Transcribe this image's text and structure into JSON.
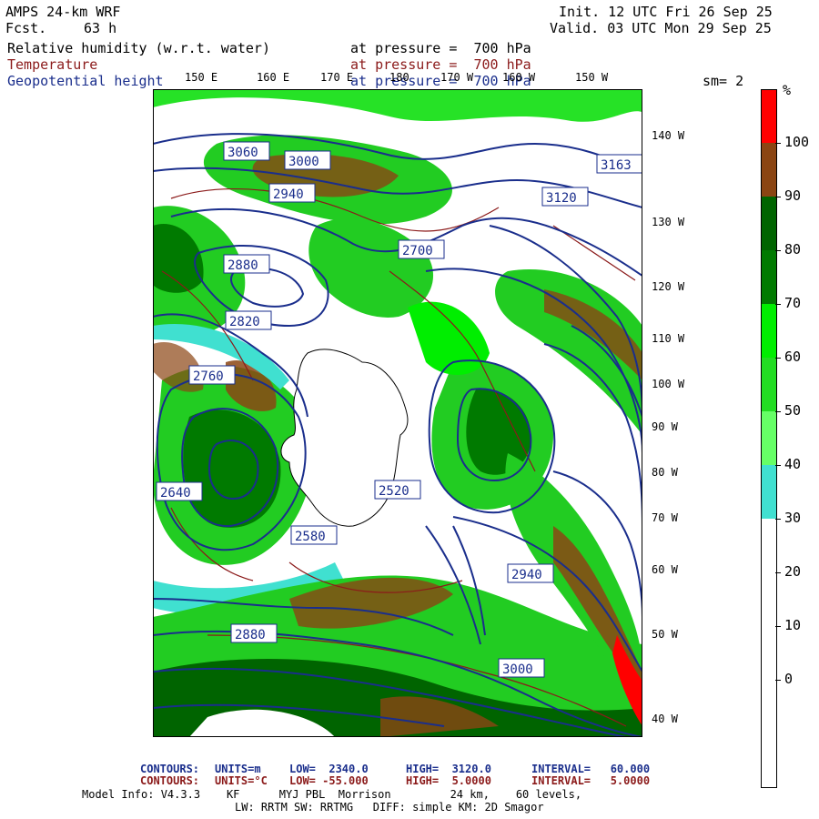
{
  "header": {
    "model": "AMPS 24-km WRF",
    "fcst_label": "Fcst.",
    "fcst_value": "63 h",
    "init": "Init. 12 UTC Fri 26 Sep 25",
    "valid": "Valid. 03 UTC Mon 29 Sep 25",
    "field1": "Relative humidity (w.r.t. water)",
    "field1_level": "at pressure =  700 hPa",
    "field2": "Temperature",
    "field2_level": "at pressure =  700 hPa",
    "field3": "Geopotential height",
    "field3_level": "at pressure =  700 hPa",
    "sm": "sm= 2"
  },
  "lon_labels": [
    "150 E",
    "160 E",
    "170 E",
    "180",
    "170 W",
    "160 W",
    "150 W"
  ],
  "lat_labels": [
    "140 W",
    "130 W",
    "120 W",
    "110 W",
    "100 W",
    "90 W",
    "80 W",
    "70 W",
    "60 W",
    "50 W",
    "40 W"
  ],
  "height_labels": [
    "3060",
    "3000",
    "2940",
    "2880",
    "2820",
    "2760",
    "2700",
    "2640",
    "2580",
    "2520",
    "3120",
    "3163",
    "2880",
    "2940",
    "3000"
  ],
  "colorbar": {
    "unit": "%",
    "colors": [
      "#ff0000",
      "#8b4513",
      "#006400",
      "#007a00",
      "#00ee00",
      "#22dd22",
      "#66ff66",
      "#40e0d0",
      "#ffffff",
      "#ffffff",
      "#ffffff",
      "#ffffff",
      "#ffffff"
    ],
    "labels": [
      "100",
      "90",
      "80",
      "70",
      "60",
      "50",
      "40",
      "30",
      "20",
      "10",
      "0"
    ]
  },
  "footer": {
    "c1_label": "CONTOURS:",
    "c1_units": "UNITS=m",
    "c1_low": "LOW=  2340.0",
    "c1_high": "HIGH=  3120.0",
    "c1_int": "INTERVAL=   60.000",
    "c2_label": "CONTOURS:",
    "c2_units": "UNITS=°C",
    "c2_low": "LOW= -55.000",
    "c2_high": "HIGH=  5.0000",
    "c2_int": "INTERVAL=   5.0000",
    "info1": "Model Info: V4.3.3    KF      MYJ PBL  Morrison         24 km,    60 levels,",
    "info2": "LW: RRTM SW: RRTMG   DIFF: simple KM: 2D Smagor"
  }
}
